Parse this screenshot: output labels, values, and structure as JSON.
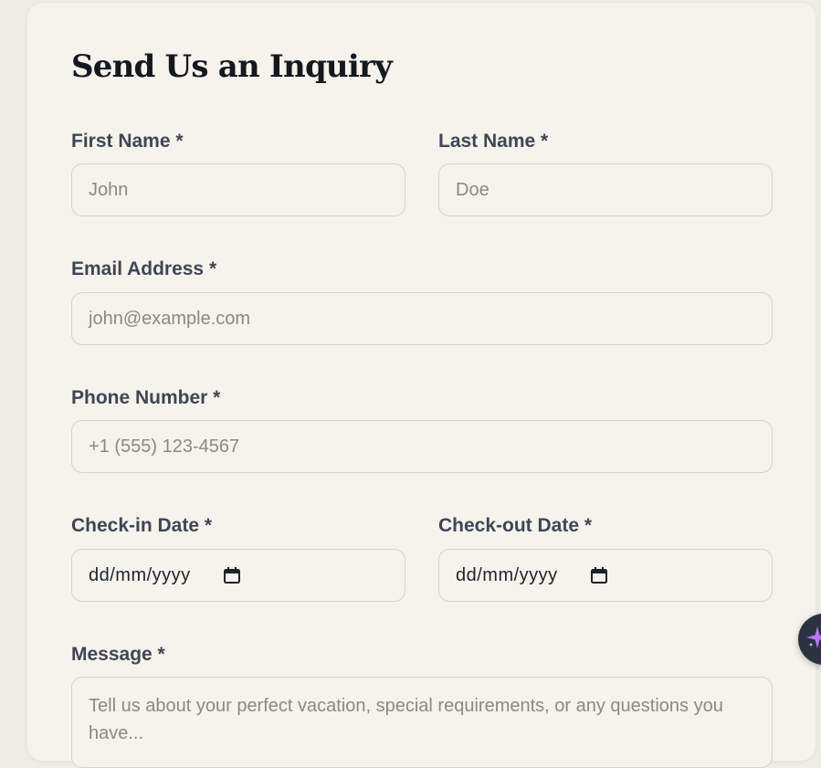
{
  "form": {
    "title": "Send Us an Inquiry",
    "first_name": {
      "label": "First Name *",
      "placeholder": "John"
    },
    "last_name": {
      "label": "Last Name *",
      "placeholder": "Doe"
    },
    "email": {
      "label": "Email Address *",
      "placeholder": "john@example.com"
    },
    "phone": {
      "label": "Phone Number *",
      "placeholder": "+1 (555) 123-4567"
    },
    "check_in": {
      "label": "Check-in Date *",
      "placeholder": "dd/mm/yyyy",
      "icon": "calendar-icon"
    },
    "check_out": {
      "label": "Check-out Date *",
      "placeholder": "dd/mm/yyyy",
      "icon": "calendar-icon"
    },
    "message": {
      "label": "Message *",
      "placeholder": "Tell us about your perfect vacation, special requirements, or any questions you have..."
    }
  },
  "assistant_button": {
    "icon": "sparkle-icon",
    "color": "#2d3240",
    "accent": "#b57bee"
  }
}
